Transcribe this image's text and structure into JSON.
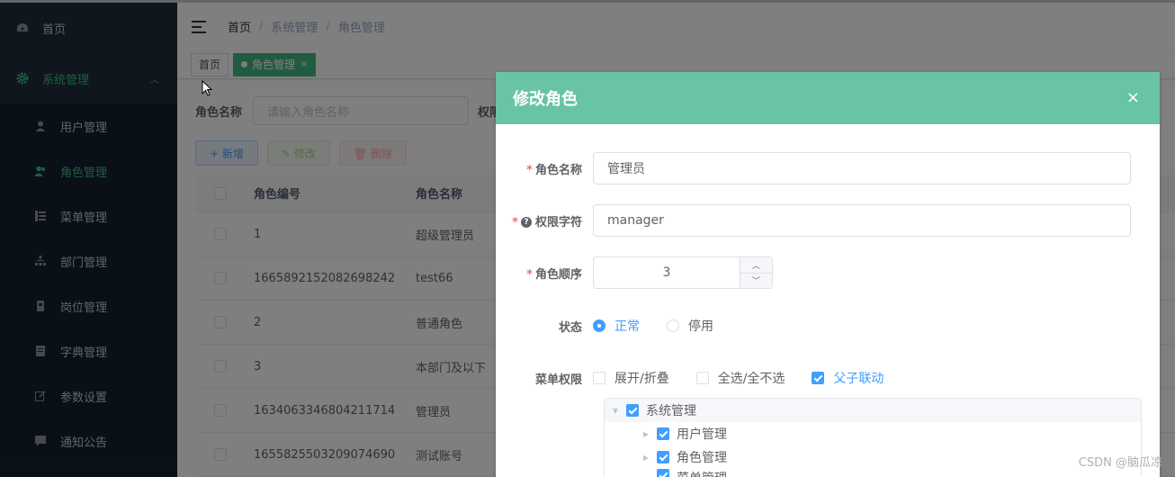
{
  "sidebar": {
    "home_label": "首页",
    "group_label": "系统管理",
    "items": [
      {
        "label": "用户管理",
        "icon": "user-icon"
      },
      {
        "label": "角色管理",
        "icon": "peoples-icon"
      },
      {
        "label": "菜单管理",
        "icon": "tree-table-icon"
      },
      {
        "label": "部门管理",
        "icon": "tree-icon"
      },
      {
        "label": "岗位管理",
        "icon": "post-icon"
      },
      {
        "label": "字典管理",
        "icon": "dict-icon"
      },
      {
        "label": "参数设置",
        "icon": "edit-icon"
      },
      {
        "label": "通知公告",
        "icon": "message-icon"
      }
    ]
  },
  "breadcrumb": [
    "首页",
    "系统管理",
    "角色管理"
  ],
  "tags": {
    "home": "首页",
    "active": "角色管理",
    "close": "×"
  },
  "search": {
    "label": "角色名称",
    "placeholder": "请输入角色名称",
    "label2": "权限"
  },
  "buttons": {
    "add": "+ 新增",
    "edit": "✎ 修改",
    "delete": "🗑 删除"
  },
  "table": {
    "headers": {
      "id": "角色编号",
      "name": "角色名称"
    },
    "rows": [
      {
        "id": "1",
        "name": "超级管理员"
      },
      {
        "id": "1665892152082698242",
        "name": "test66"
      },
      {
        "id": "2",
        "name": "普通角色"
      },
      {
        "id": "3",
        "name": "本部门及以下"
      },
      {
        "id": "1634063346804211714",
        "name": "管理员"
      },
      {
        "id": "1655825503209074690",
        "name": "测试账号"
      }
    ]
  },
  "dialog": {
    "title": "修改角色",
    "close": "×",
    "role_name_label": "角色名称",
    "role_name_value": "管理员",
    "perm_label": "权限字符",
    "perm_value": "manager",
    "order_label": "角色顺序",
    "order_value": "3",
    "status_label": "状态",
    "status_normal": "正常",
    "status_disabled": "停用",
    "menu_label": "菜单权限",
    "expand_label": "展开/折叠",
    "select_all_label": "全选/全不选",
    "linkage_label": "父子联动",
    "tree": [
      "系统管理",
      "用户管理",
      "角色管理",
      "菜单管理"
    ],
    "accent_color": "#409eff",
    "header_color": "#69c4a3"
  },
  "watermark": "CSDN @脑瓜凉"
}
